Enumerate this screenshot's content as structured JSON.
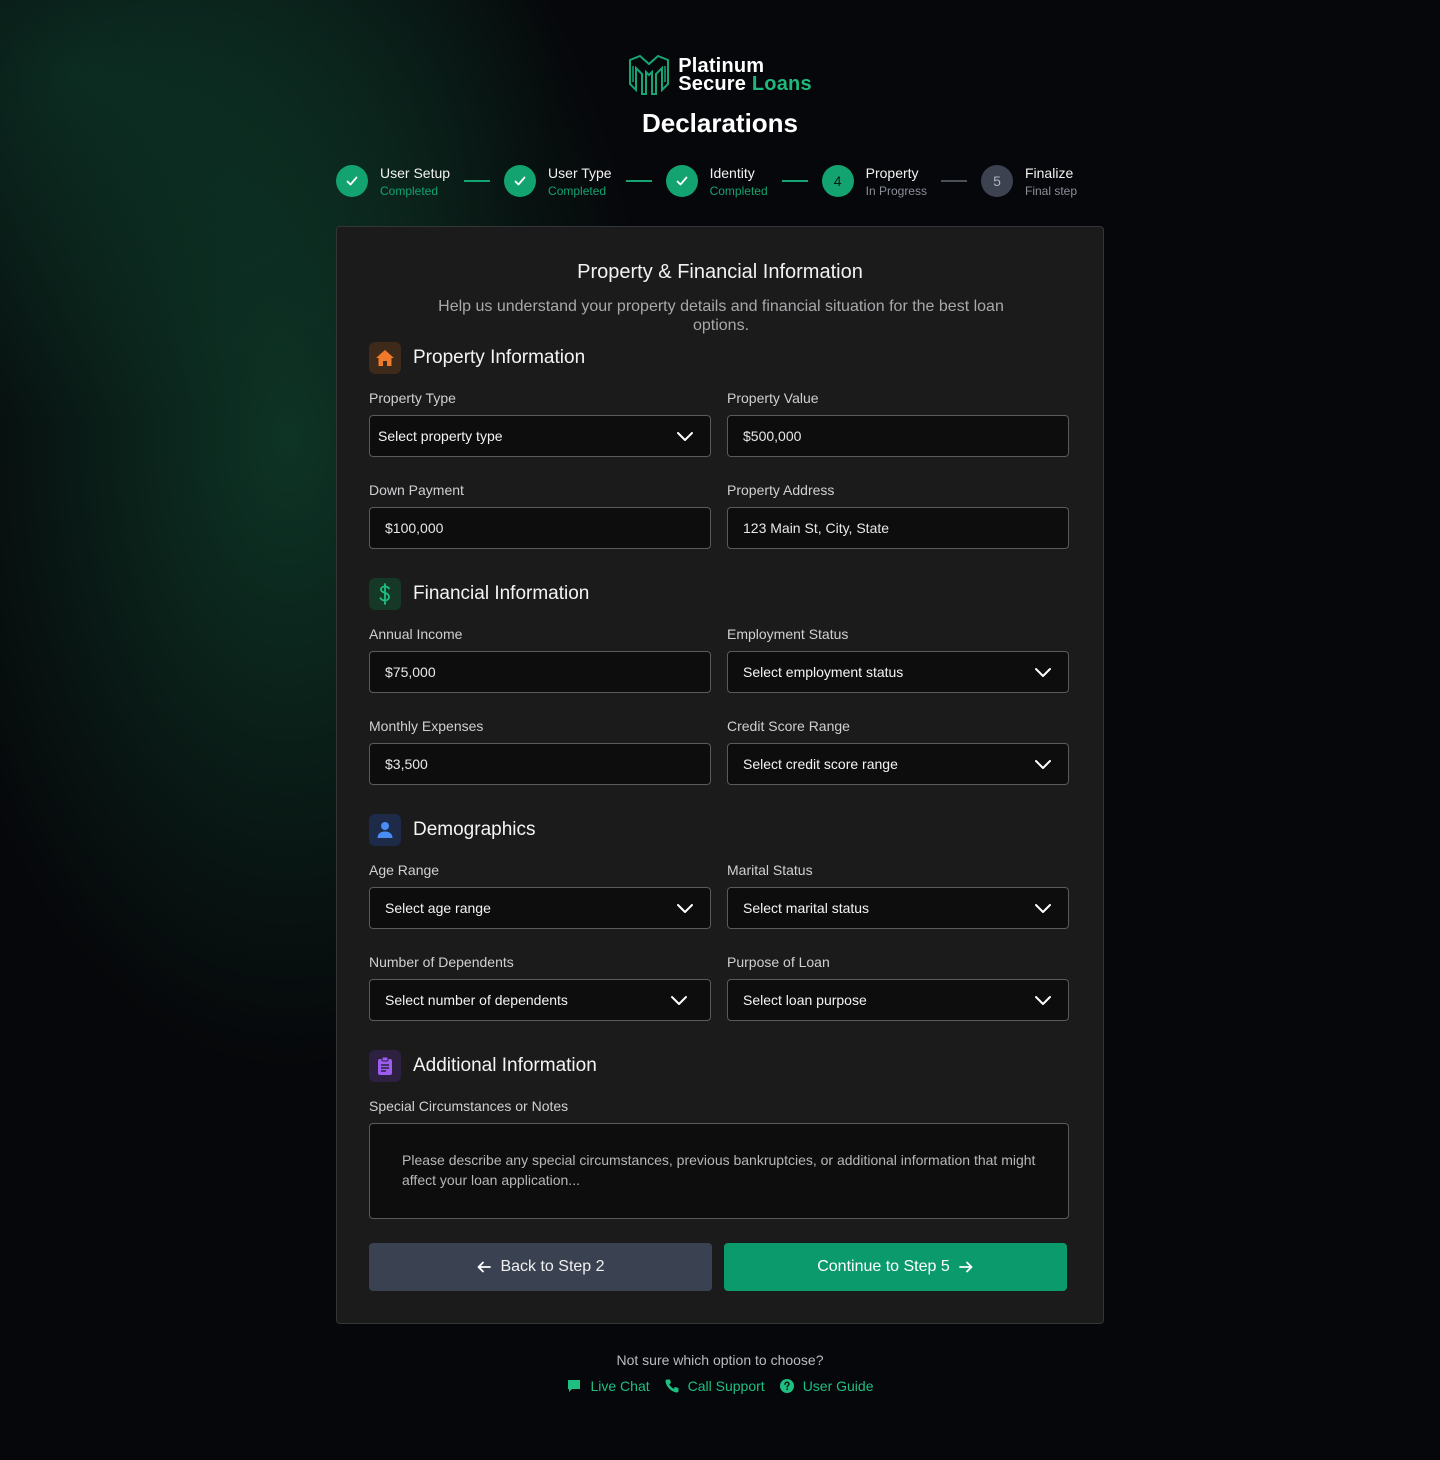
{
  "brand": {
    "line1": "Platinum",
    "line2_a": "Secure",
    "line2_b": "Loans",
    "accent": "#1fb87c"
  },
  "page_title": "Declarations",
  "steps": [
    {
      "number": "1",
      "title": "User Setup",
      "status": "Completed",
      "state": "done"
    },
    {
      "number": "2",
      "title": "User Type",
      "status": "Completed",
      "state": "done"
    },
    {
      "number": "3",
      "title": "Identity",
      "status": "Completed",
      "state": "done"
    },
    {
      "number": "4",
      "title": "Property",
      "status": "In Progress",
      "state": "active"
    },
    {
      "number": "5",
      "title": "Finalize",
      "status": "Final step",
      "state": "pending"
    }
  ],
  "card": {
    "title": "Property & Financial Information",
    "subtitle": "Help us understand your property details and financial situation for the best loan options."
  },
  "sections": {
    "property": {
      "title": "Property Information",
      "icon": "house-icon",
      "property_type": {
        "label": "Property Type",
        "value": "Select property type"
      },
      "property_value": {
        "label": "Property Value",
        "placeholder": "$500,000"
      },
      "down_payment": {
        "label": "Down Payment",
        "placeholder": "$100,000"
      },
      "address": {
        "label": "Property Address",
        "placeholder": "123 Main St, City, State"
      }
    },
    "financial": {
      "title": "Financial Information",
      "icon": "dollar-icon",
      "annual_income": {
        "label": "Annual Income",
        "placeholder": "$75,000"
      },
      "employment": {
        "label": "Employment Status",
        "value": "Select employment status"
      },
      "monthly_expenses": {
        "label": "Monthly Expenses",
        "placeholder": "$3,500"
      },
      "credit_score": {
        "label": "Credit Score Range",
        "value": "Select credit score range"
      }
    },
    "demographics": {
      "title": "Demographics",
      "icon": "user-icon",
      "age": {
        "label": "Age Range",
        "value": "Select age range"
      },
      "marital": {
        "label": "Marital Status",
        "value": "Select marital status"
      },
      "dependents": {
        "label": "Number of Dependents",
        "value": "Select number of dependents"
      },
      "purpose": {
        "label": "Purpose of Loan",
        "value": "Select loan purpose"
      }
    },
    "additional": {
      "title": "Additional Information",
      "icon": "clipboard-icon",
      "notes": {
        "label": "Special Circumstances or Notes",
        "placeholder": "Please describe any special circumstances, previous bankruptcies, or additional information that might affect your loan application..."
      }
    }
  },
  "buttons": {
    "back": "Back to Step 2",
    "next": "Continue to Step 5"
  },
  "help": {
    "question": "Not sure which option to choose?",
    "links": [
      {
        "label": "Live Chat",
        "icon": "chat-icon"
      },
      {
        "label": "Call Support",
        "icon": "phone-icon"
      },
      {
        "label": "User Guide",
        "icon": "help-circle-icon"
      }
    ]
  }
}
